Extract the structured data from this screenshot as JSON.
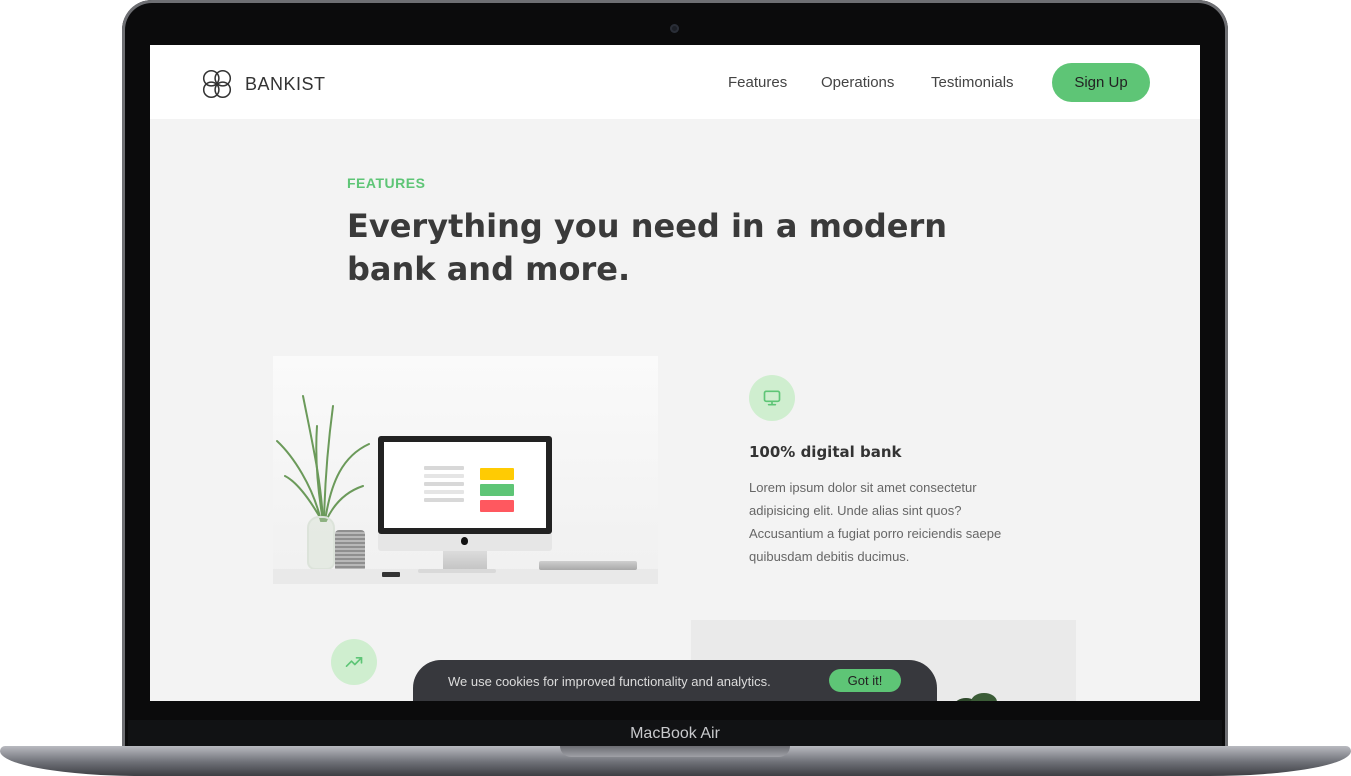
{
  "device": {
    "label": "MacBook Air"
  },
  "nav": {
    "logo_text": "BANKIST",
    "links": [
      "Features",
      "Operations",
      "Testimonials"
    ],
    "signup_label": "Sign Up"
  },
  "section": {
    "tag": "FEATURES",
    "title": "Everything you need in a modern bank and more."
  },
  "features": [
    {
      "icon": "monitor-icon",
      "title": "100% digital bank",
      "text": "Lorem ipsum dolor sit amet consectetur adipisicing elit. Unde alias sint quos? Accusantium a fugiat porro reiciendis saepe quibusdam debitis ducimus."
    },
    {
      "icon": "trending-up-icon"
    }
  ],
  "cookie": {
    "message": "We use cookies for improved functionality and analytics.",
    "button_label": "Got it!"
  },
  "colors": {
    "accent": "#5ec576",
    "icon_bg": "#cfeecf",
    "page_bg": "#f3f3f3",
    "cookie_bg": "#37383d"
  }
}
